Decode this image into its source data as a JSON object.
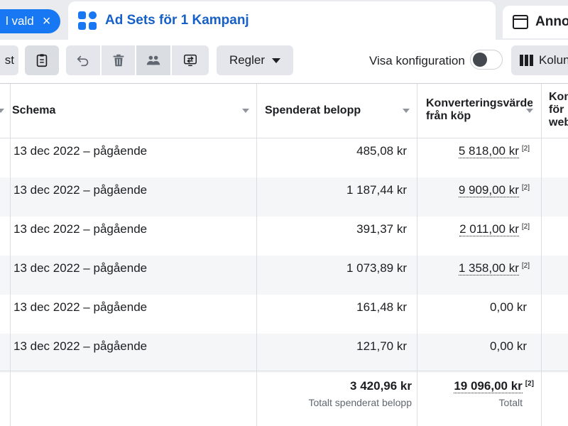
{
  "tabs": {
    "selection_chip": "l vald",
    "active_tab": "Ad Sets för 1 Kampanj",
    "next_tab": "Anno"
  },
  "toolbar": {
    "left_partial": "st",
    "rules_label": "Regler",
    "show_config_label": "Visa konfiguration",
    "show_config_on": false,
    "columns_label": "Kolun"
  },
  "table": {
    "columns": {
      "schema": "Schema",
      "spent": "Spenderat belopp",
      "conv_line1": "Konverteringsvärde",
      "conv_line2": "från köp",
      "next_line1": "Kon",
      "next_line2": "för",
      "next_line3": "web"
    },
    "rows": [
      {
        "schema": "13 dec 2022 – pågående",
        "spent": "485,08 kr",
        "conv": "5 818,00 kr",
        "conv_ref": "[2]"
      },
      {
        "schema": "13 dec 2022 – pågående",
        "spent": "1 187,44 kr",
        "conv": "9 909,00 kr",
        "conv_ref": "[2]"
      },
      {
        "schema": "13 dec 2022 – pågående",
        "spent": "391,37 kr",
        "conv": "2 011,00 kr",
        "conv_ref": "[2]"
      },
      {
        "schema": "13 dec 2022 – pågående",
        "spent": "1 073,89 kr",
        "conv": "1 358,00 kr",
        "conv_ref": "[2]"
      },
      {
        "schema": "13 dec 2022 – pågående",
        "spent": "161,48 kr",
        "conv": "0,00 kr",
        "conv_ref": ""
      },
      {
        "schema": "13 dec 2022 – pågående",
        "spent": "121,70 kr",
        "conv": "0,00 kr",
        "conv_ref": ""
      }
    ],
    "totals": {
      "spent": "3 420,96 kr",
      "spent_label": "Totalt spenderat belopp",
      "conv": "19 096,00 kr",
      "conv_ref": "[2]",
      "conv_label": "Totalt"
    }
  },
  "colors": {
    "accent": "#1877f2",
    "accent_text": "#1660c7",
    "row_shade": "#f5f6f7"
  },
  "icons": [
    "close-icon",
    "ad-sets-grid-icon",
    "window-icon",
    "clipboard-icon",
    "undo-icon",
    "trash-icon",
    "people-icon",
    "swap-icon",
    "caret-down-icon",
    "columns-icon",
    "sort-icon"
  ]
}
